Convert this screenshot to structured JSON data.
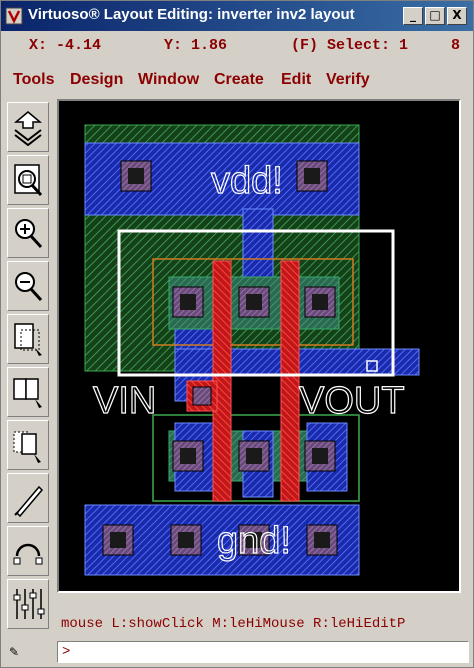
{
  "window": {
    "title": "Virtuoso® Layout Editing: inverter inv2 layout",
    "controls": {
      "minimize": "_",
      "maximize": "□",
      "close": "X"
    }
  },
  "status": {
    "x": "X: -4.14",
    "y": "Y: 1.86",
    "select": "(F) Select: 1",
    "number": "8"
  },
  "menu": [
    "Tools",
    "Design",
    "Window",
    "Create",
    "Edit",
    "Verify"
  ],
  "toolbar": [
    "save-icon",
    "fit-view-icon",
    "zoom-in-icon",
    "zoom-out-icon",
    "stretch-icon",
    "copy-icon",
    "move-icon",
    "ruler-icon",
    "undo-icon",
    "properties-icon"
  ],
  "layout_labels": {
    "vdd": "vdd!",
    "gnd": "gnd!",
    "vin": "VIN",
    "vout": "VOUT"
  },
  "mouse_bar": "mouse L:showClick M:leHiMouse R:leHiEditP",
  "command": {
    "prompt": ">"
  },
  "colors": {
    "nwell": "#2e8b3a",
    "metal1": "#2a3aff",
    "poly": "#e02020",
    "diffusion": "#2e8b57",
    "contact": "#8a6a8a",
    "selection": "#ffffff"
  }
}
